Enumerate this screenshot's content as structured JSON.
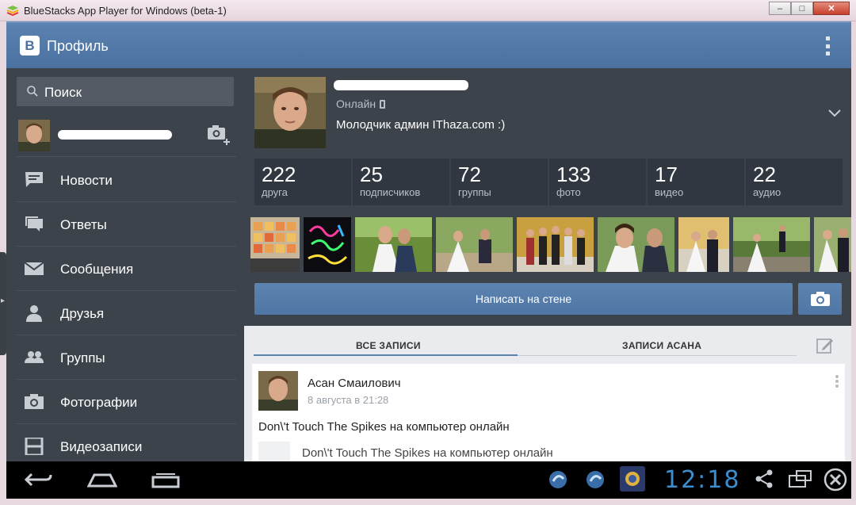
{
  "window": {
    "title": "BlueStacks App Player for Windows (beta-1)",
    "min": "–",
    "max": "□",
    "close": "✕"
  },
  "appbar": {
    "logo": "B",
    "title": "Профиль"
  },
  "sidebar": {
    "search_label": "Поиск",
    "items": [
      {
        "label": "Новости",
        "icon": "news-icon"
      },
      {
        "label": "Ответы",
        "icon": "replies-icon"
      },
      {
        "label": "Сообщения",
        "icon": "messages-icon"
      },
      {
        "label": "Друзья",
        "icon": "friends-icon"
      },
      {
        "label": "Группы",
        "icon": "groups-icon"
      },
      {
        "label": "Фотографии",
        "icon": "photos-icon"
      },
      {
        "label": "Видеозаписи",
        "icon": "videos-icon"
      }
    ]
  },
  "profile": {
    "online": "Онлайн",
    "status": "Молодчик админ IThaza.com :)",
    "counters": [
      {
        "num": "222",
        "label": "друга"
      },
      {
        "num": "25",
        "label": "подписчиков"
      },
      {
        "num": "72",
        "label": "группы"
      },
      {
        "num": "133",
        "label": "фото"
      },
      {
        "num": "17",
        "label": "видео"
      },
      {
        "num": "22",
        "label": "аудио"
      }
    ],
    "wall_button": "Написать на стене"
  },
  "feed": {
    "tabs": [
      "ВСЕ ЗАПИСИ",
      "ЗАПИСИ АСАНА"
    ],
    "post": {
      "author": "Асан Смаилович",
      "date": "8 августа в 21:28",
      "text": "Don\\'t Touch The Spikes на компьютер онлайн",
      "attachment": "Don\\'t Touch The Spikes на компьютер онлайн"
    }
  },
  "navbar": {
    "clock": "12:18"
  },
  "colors": {
    "appbar": "#4a71a0",
    "sidebar": "#3d434b",
    "accent": "#3b8fd0"
  }
}
